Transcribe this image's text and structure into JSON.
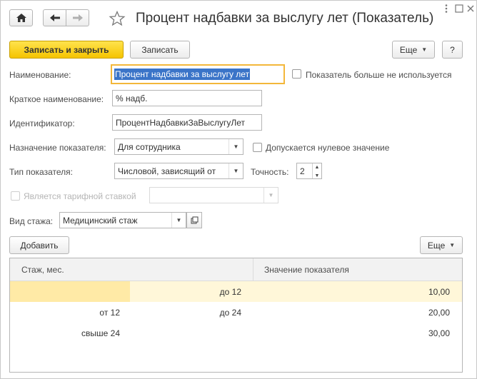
{
  "window": {
    "title": "Процент надбавки за выслугу лет (Показатель)"
  },
  "colors": {
    "primary_button": "#f5c400",
    "focus_border": "#f3b73a",
    "selection": "#3a74c8",
    "selected_row": "#fff7d9",
    "selected_cell": "#ffeaa6"
  },
  "toolbar": {
    "save_close_label": "Записать и закрыть",
    "save_label": "Записать",
    "more_label": "Еще",
    "help_label": "?"
  },
  "form": {
    "name_label": "Наименование:",
    "name_value": "Процент надбавки за выслугу лет",
    "unused_label": "Показатель больше не используется",
    "short_name_label": "Краткое наименование:",
    "short_name_value": "% надб.",
    "id_label": "Идентификатор:",
    "id_value": "ПроцентНадбавкиЗаВыслугуЛет",
    "purpose_label": "Назначение показателя:",
    "purpose_value": "Для сотрудника",
    "zero_allowed_label": "Допускается нулевое значение",
    "type_label": "Тип показателя:",
    "type_value": "Числовой, зависящий от",
    "precision_label": "Точность:",
    "precision_value": "2",
    "tariff_label": "Является тарифной ставкой",
    "tariff_value": "",
    "stazh_label": "Вид стажа:",
    "stazh_value": "Медицинский стаж"
  },
  "table_toolbar": {
    "add_label": "Добавить",
    "more_label": "Еще"
  },
  "table": {
    "columns": [
      "Стаж, мес.",
      "Значение показателя"
    ],
    "rows": [
      {
        "from": "",
        "to": "до 12",
        "value": "10,00"
      },
      {
        "from": "от 12",
        "to": "до 24",
        "value": "20,00"
      },
      {
        "from": "свыше 24",
        "to": "",
        "value": "30,00"
      }
    ]
  }
}
